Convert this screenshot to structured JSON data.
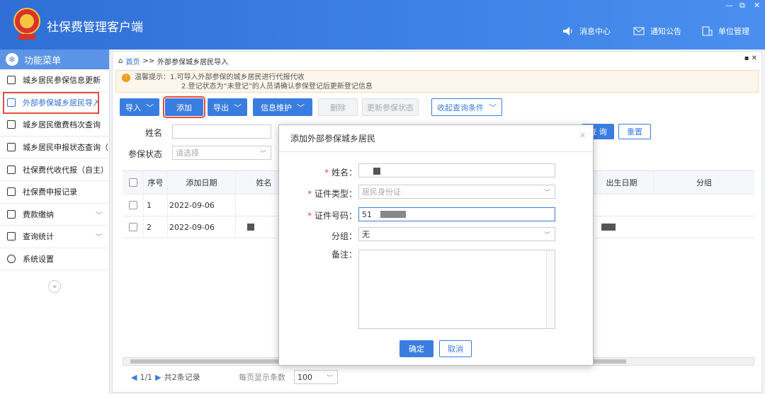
{
  "app": {
    "title": "社保费管理客户端"
  },
  "window": {
    "minimize": "—",
    "restore": "⧉",
    "close": "✕"
  },
  "header_buttons": [
    {
      "label": "消息中心",
      "icon": "speaker-icon"
    },
    {
      "label": "通知公告",
      "icon": "mail-icon"
    },
    {
      "label": "单位管理",
      "icon": "building-icon"
    }
  ],
  "sidebar": {
    "title": "功能菜单",
    "items": [
      {
        "label": "城乡居民参保信息更新"
      },
      {
        "label": "外部参保城乡居民导入",
        "active": true
      },
      {
        "label": "城乡居民缴费档次查询"
      },
      {
        "label": "城乡居民申报状态查询（自主"
      },
      {
        "label": "社保费代收代报（自主）"
      },
      {
        "label": "社保费申报记录"
      },
      {
        "label": "费款缴纳",
        "expandable": true
      },
      {
        "label": "查询统计",
        "expandable": true
      },
      {
        "label": "系统设置"
      }
    ],
    "collapse": "«"
  },
  "breadcrumb": {
    "home": "首页",
    "separator": ">>",
    "current": "外部参保城乡居民导入"
  },
  "tip": {
    "line1": "温馨提示：1.可导入外部参保的城乡居民进行代报代收",
    "line2": "2.登记状态为“未登记”的人员请确认参保登记后更新登记信息"
  },
  "toolbar": {
    "import": "导入",
    "add": "添加",
    "export": "导出",
    "info_maintain": "信息维护",
    "delete": "删除",
    "update_status": "更新参保状态",
    "collapse_query": "收起查询条件",
    "query": "查 询",
    "reset": "重置"
  },
  "filters": {
    "name_label": "姓名",
    "status_label": "参保状态",
    "status_placeholder": "请选择"
  },
  "table": {
    "headers": {
      "seq": "序号",
      "date": "添加日期",
      "name": "姓名",
      "birth": "出生日期",
      "group": "分组"
    },
    "rows": [
      {
        "seq": "1",
        "date": "2022-09-06"
      },
      {
        "seq": "2",
        "date": "2022-09-06"
      }
    ]
  },
  "pager": {
    "prev": "◀",
    "page": "1/1",
    "next": "▶",
    "total": "共2条记录",
    "per_page_label": "每页显示条数",
    "per_page_value": "100"
  },
  "dialog": {
    "title": "添加外部参保城乡居民",
    "close": "✕",
    "fields": {
      "name_label": "姓名：",
      "idtype_label": "证件类型：",
      "idtype_value": "居民身份证",
      "idno_label": "证件号码：",
      "idno_value": "51",
      "group_label": "分组：",
      "group_value": "无",
      "remark_label": "备注："
    },
    "ok": "确定",
    "cancel": "取消"
  },
  "colors": {
    "primary": "#3a7de0",
    "header": "#2f6fd6",
    "highlight": "#e74c3c"
  }
}
